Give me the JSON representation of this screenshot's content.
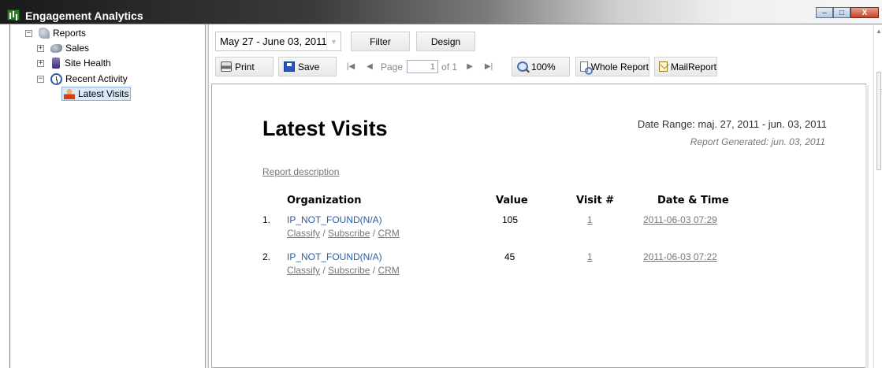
{
  "window": {
    "title": "Engagement Analytics",
    "buttons": {
      "minimize": "–",
      "maximize": "□",
      "close": "X"
    }
  },
  "tree": {
    "root": {
      "label": "Reports",
      "expander": "−"
    },
    "items": [
      {
        "label": "Sales",
        "expander": "+"
      },
      {
        "label": "Site Health",
        "expander": "+"
      },
      {
        "label": "Recent Activity",
        "expander": "−"
      }
    ],
    "selected": {
      "label": "Latest Visits"
    }
  },
  "toolbar": {
    "date_range_value": "May 27 - June 03, 2011",
    "filter_label": "Filter",
    "design_label": "Design",
    "print_label": "Print",
    "save_label": "Save",
    "page_label": "Page",
    "page_value": "1",
    "page_of": "of 1",
    "zoom_label": "100%",
    "whole_report_label": "Whole Report",
    "mail_report_label": "MailReport"
  },
  "report": {
    "title": "Latest Visits",
    "date_range": "Date Range: maj. 27, 2011 - jun. 03, 2011",
    "generated": "Report Generated: jun. 03, 2011",
    "description_link": "Report description",
    "columns": [
      "Organization",
      "Value",
      "Visit #",
      "Date & Time"
    ],
    "rows": [
      {
        "index": "1.",
        "organization": "IP_NOT_FOUND(N/A)",
        "value": "105",
        "visit": "1",
        "datetime": "2011-06-03 07:29",
        "actions": [
          "Classify",
          "Subscribe",
          "CRM"
        ]
      },
      {
        "index": "2.",
        "organization": "IP_NOT_FOUND(N/A)",
        "value": "45",
        "visit": "1",
        "datetime": "2011-06-03 07:22",
        "actions": [
          "Classify",
          "Subscribe",
          "CRM"
        ]
      }
    ],
    "action_separator": "/"
  },
  "colors": {
    "link_blue": "#2a5aa8",
    "selection_bg": "#dbe9f8",
    "muted_text": "#777777"
  }
}
